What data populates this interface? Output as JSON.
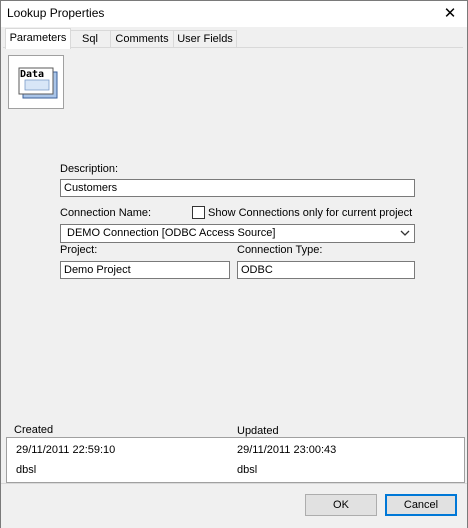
{
  "window": {
    "title": "Lookup Properties",
    "close_glyph": "✕"
  },
  "tabs": [
    {
      "label": "Parameters",
      "active": true
    },
    {
      "label": "Sql"
    },
    {
      "label": "Comments"
    },
    {
      "label": "User Fields"
    }
  ],
  "icon": {
    "name": "data-icon",
    "text": "Data"
  },
  "form": {
    "description_label": "Description:",
    "description_value": "Customers",
    "connection_name_label": "Connection Name:",
    "show_connections_label": "Show Connections only for current project",
    "show_connections_checked": false,
    "connection_value": "DEMO Connection [ODBC Access Source]",
    "project_label": "Project:",
    "project_value": "Demo Project",
    "connection_type_label": "Connection Type:",
    "connection_type_value": "ODBC"
  },
  "info": {
    "created_label": "Created",
    "updated_label": "Updated",
    "created_date": "29/11/2011 22:59:10",
    "created_by": "dbsl",
    "updated_date": "29/11/2011 23:00:43",
    "updated_by": "dbsl"
  },
  "buttons": {
    "ok": "OK",
    "cancel": "Cancel"
  },
  "colors": {
    "accent": "#0078d7",
    "panel": "#f0f0f0",
    "field_border": "#7a7a7a"
  }
}
